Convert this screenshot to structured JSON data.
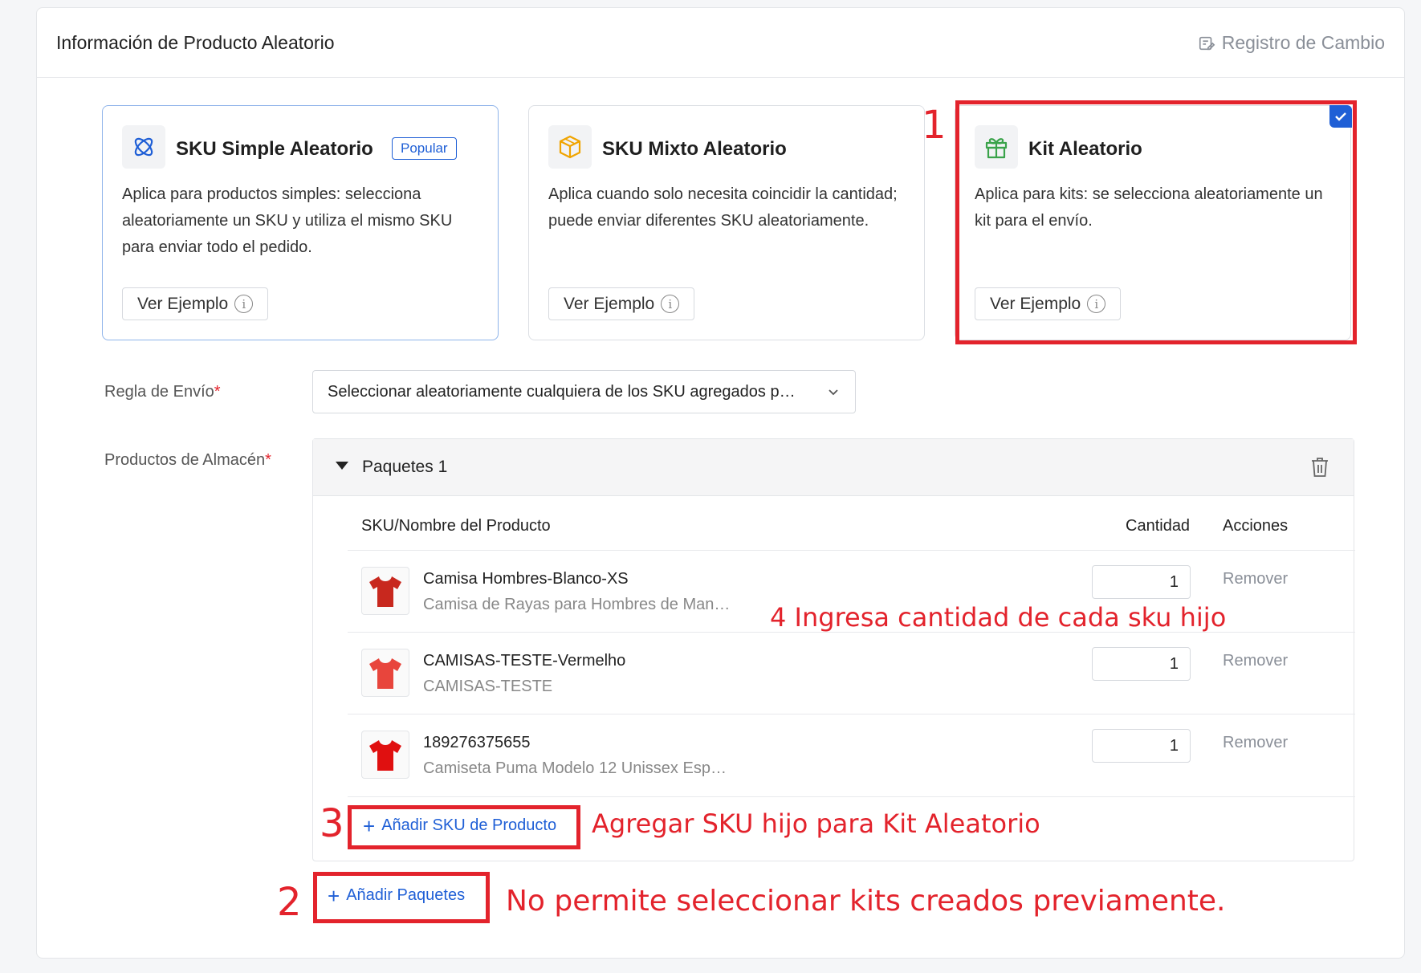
{
  "header": {
    "title": "Información de Producto Aleatorio",
    "changelog": "Registro de Cambio"
  },
  "cards": [
    {
      "title": "SKU Simple Aleatorio",
      "badge": "Popular",
      "description": "Aplica para productos simples: selecciona aleatoriamente un SKU y utiliza el mismo SKU para enviar todo el pedido.",
      "button": "Ver Ejemplo",
      "icon": "atom-icon"
    },
    {
      "title": "SKU Mixto Aleatorio",
      "description": "Aplica cuando solo necesita coincidir la cantidad; puede enviar diferentes SKU aleatoriamente.",
      "button": "Ver Ejemplo",
      "icon": "box-icon"
    },
    {
      "title": "Kit Aleatorio",
      "description": "Aplica para kits: se selecciona aleatoriamente un kit para el envío.",
      "button": "Ver Ejemplo",
      "icon": "gift-icon",
      "selected": true
    }
  ],
  "info_glyph": "i",
  "shipping_rule": {
    "label": "Regla de Envío",
    "required": "*",
    "value": "Seleccionar aleatoriamente cualquiera de los SKU agregados p…"
  },
  "warehouse": {
    "label": "Productos de Almacén",
    "required": "*",
    "package_title": "Paquetes 1",
    "columns": {
      "sku": "SKU/Nombre del Producto",
      "qty": "Cantidad",
      "actions": "Acciones"
    },
    "rows": [
      {
        "name": "Camisa Hombres-Blanco-XS",
        "sub": "Camisa de Rayas para Hombres de Man…",
        "qty": "1",
        "action": "Remover",
        "color": "#c8281e"
      },
      {
        "name": "CAMISAS-TESTE-Vermelho",
        "sub": "CAMISAS-TESTE",
        "qty": "1",
        "action": "Remover",
        "color": "#e8453c"
      },
      {
        "name": "189276375655",
        "sub": "Camiseta Puma Modelo 12 Unissex Esp…",
        "qty": "1",
        "action": "Remover",
        "color": "#e01010"
      }
    ],
    "add_sku": "Añadir SKU de Producto",
    "add_package": "Añadir Paquetes",
    "plus": "+"
  },
  "annotations": {
    "n1": "1",
    "n2": "2",
    "n3": "3",
    "qty_note": "4 Ingresa cantidad de cada sku hijo",
    "add_sku_note": "Agregar SKU hijo para Kit Aleatorio",
    "add_package_note": "No permite seleccionar kits creados previamente."
  },
  "colors": {
    "accent": "#1f5fd6",
    "annotation": "#e3232c"
  }
}
